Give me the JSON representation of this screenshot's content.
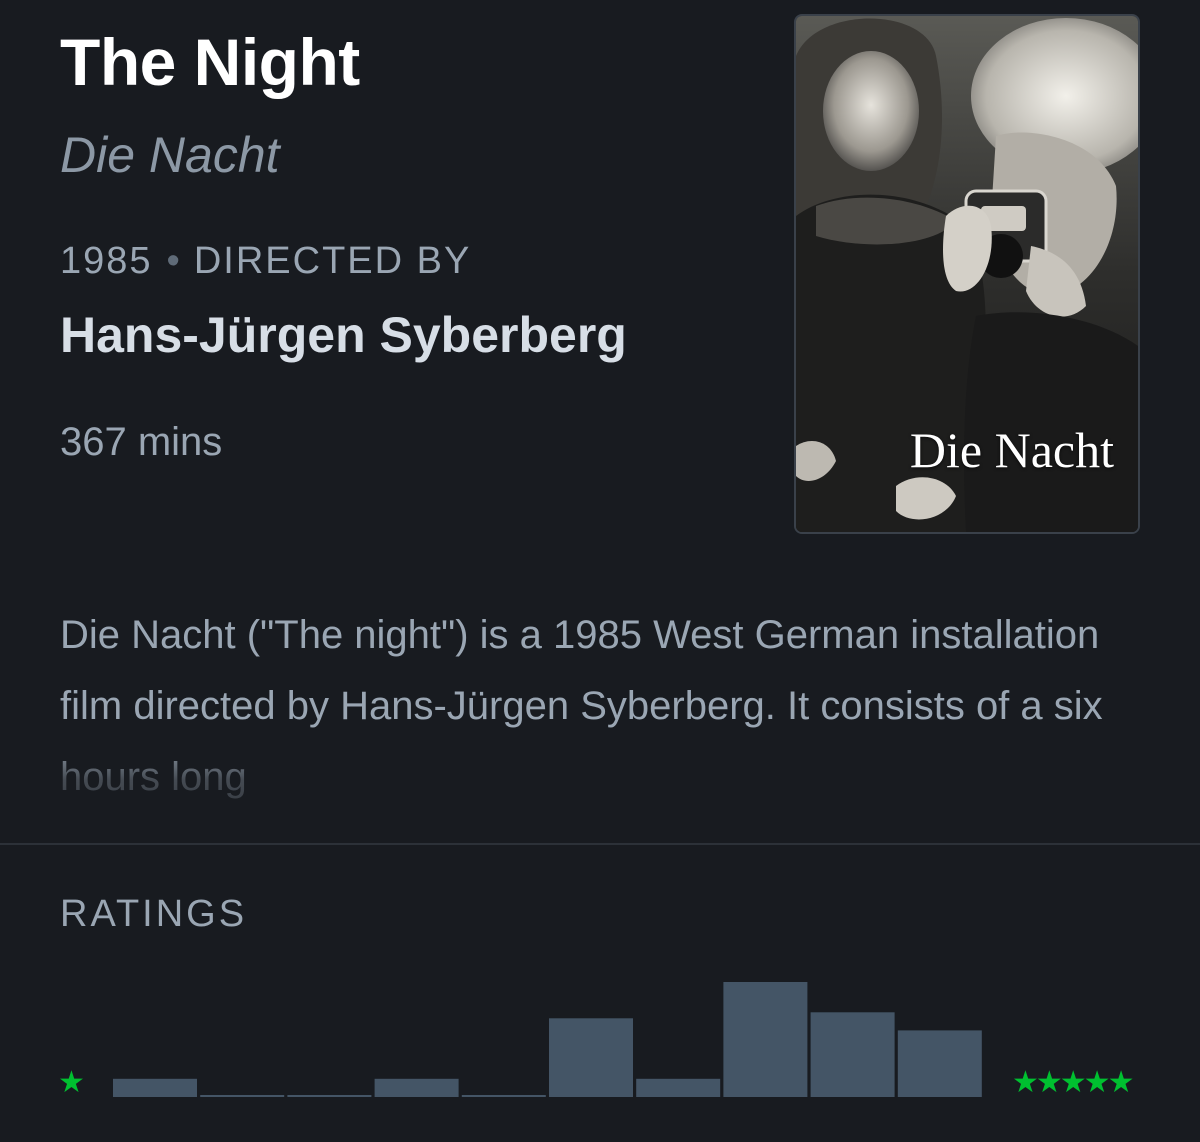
{
  "film": {
    "title": "The Night",
    "original_title": "Die Nacht",
    "year": "1985",
    "separator": "•",
    "directed_by_label": "DIRECTED BY",
    "director": "Hans-Jürgen Syberberg",
    "runtime": "367 mins",
    "synopsis": "Die Nacht (\"The night\") is a 1985 West German installation film directed by Hans-Jürgen Syberberg. It consists of a six hours long"
  },
  "poster": {
    "title_text": "Die Nacht",
    "icon": "film-poster-image"
  },
  "ratings": {
    "header": "RATINGS",
    "min_stars": "★",
    "max_stars": "★★★★★",
    "star_color": "#00c030",
    "bar_color": "#445566"
  },
  "chart_data": {
    "type": "bar",
    "categories": [
      "0.5",
      "1",
      "1.5",
      "2",
      "2.5",
      "3",
      "3.5",
      "4",
      "4.5",
      "5"
    ],
    "values": [
      3,
      0.3,
      0.3,
      3,
      0.3,
      13,
      3,
      19,
      14,
      11
    ],
    "ylim": [
      0,
      19
    ]
  }
}
